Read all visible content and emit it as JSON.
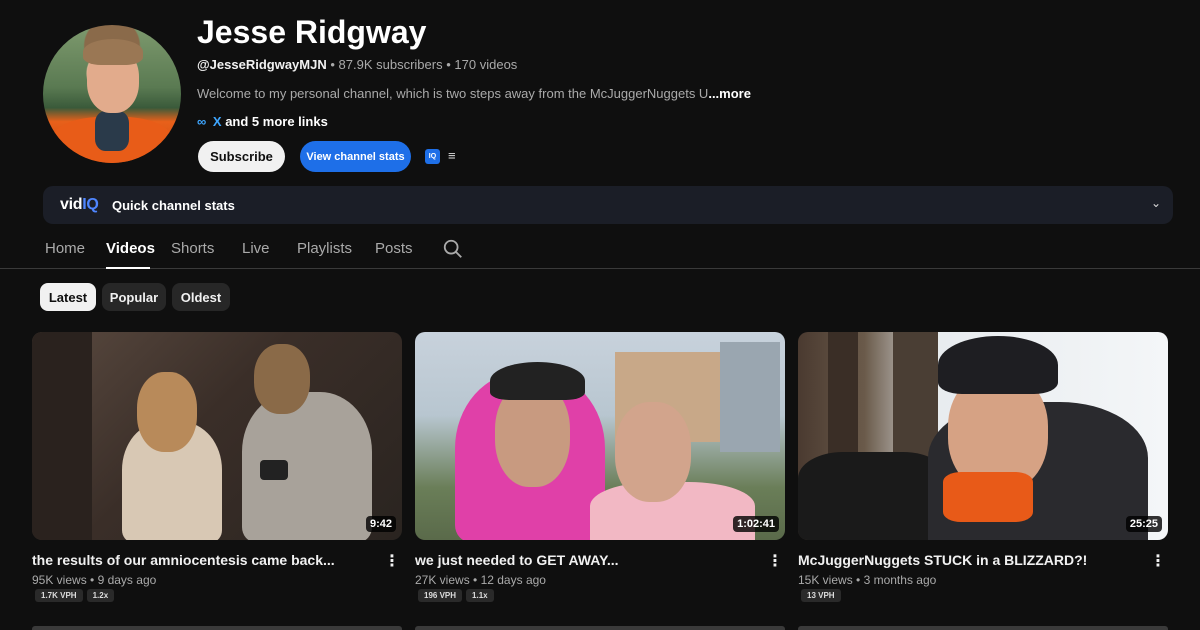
{
  "channel": {
    "name": "Jesse Ridgway",
    "handle": "@JesseRidgwayMJN",
    "subscribers": "87.9K subscribers",
    "videos": "170 videos",
    "separator": "•",
    "description_visible": "Welcome to my personal channel, which is two steps away from the McJuggerNuggets U",
    "description_more": "...more",
    "links_icon": "link-icon",
    "links_primary": "X",
    "links_rest": "and 5 more links"
  },
  "buttons": {
    "subscribe": "Subscribe",
    "channel_stats": "View channel stats",
    "vidiq_icon": "IQ"
  },
  "vidiq": {
    "logo_vid": "vid",
    "logo_iq": "IQ",
    "label": "Quick channel stats"
  },
  "tabs": [
    {
      "label": "Home",
      "active": false
    },
    {
      "label": "Videos",
      "active": true
    },
    {
      "label": "Shorts",
      "active": false
    },
    {
      "label": "Live",
      "active": false
    },
    {
      "label": "Playlists",
      "active": false
    },
    {
      "label": "Posts",
      "active": false
    }
  ],
  "sort_chips": [
    {
      "label": "Latest",
      "active": true
    },
    {
      "label": "Popular",
      "active": false
    },
    {
      "label": "Oldest",
      "active": false
    }
  ],
  "videos": [
    {
      "title": "the results of our amniocentesis came back...",
      "views": "95K views",
      "age": "9 days ago",
      "duration": "9:42",
      "vph": "1.7K VPH",
      "multiplier": "1.2x"
    },
    {
      "title": "we just needed to GET AWAY...",
      "views": "27K views",
      "age": "12 days ago",
      "duration": "1:02:41",
      "vph": "196 VPH",
      "multiplier": "1.1x"
    },
    {
      "title": "McJuggerNuggets STUCK in a BLIZZARD?!",
      "views": "15K views",
      "age": "3 months ago",
      "duration": "25:25",
      "vph": "13 VPH",
      "multiplier": ""
    }
  ],
  "colors": {
    "background": "#0f0f0f",
    "accent_blue": "#1e6fe8",
    "vidiq_bar": "#1b1e27"
  }
}
